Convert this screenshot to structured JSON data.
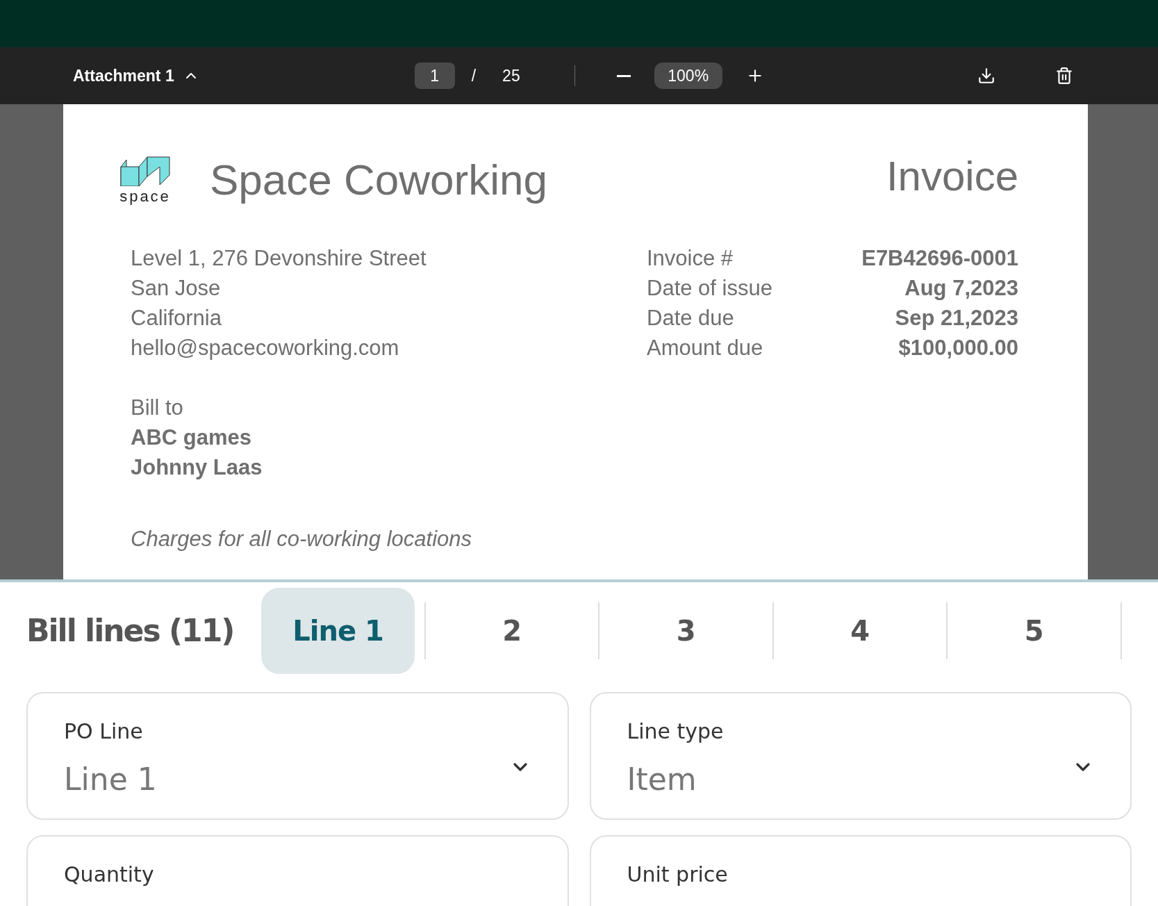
{
  "toolbar": {
    "attachment": "Attachment 1",
    "page": "1",
    "separator": "/",
    "page_count": "25",
    "zoom": "100%"
  },
  "invoice": {
    "logo_text": "space",
    "company": "Space Coworking",
    "title": "Invoice",
    "address": [
      "Level 1, 276 Devonshire Street",
      "San Jose",
      "California",
      "hello@spacecoworking.com"
    ],
    "details": [
      {
        "label": "Invoice #",
        "value": "E7B42696-0001"
      },
      {
        "label": "Date of issue",
        "value": "Aug 7,2023"
      },
      {
        "label": "Date due",
        "value": "Sep 21,2023"
      },
      {
        "label": "Amount due",
        "value": "$100,000.00"
      }
    ],
    "bill_to": {
      "label": "Bill to",
      "lines": [
        "ABC games",
        "Johnny Laas"
      ]
    },
    "note": "Charges for all co-working locations"
  },
  "bill_lines": {
    "title": "Bill lines (11)",
    "tabs": [
      {
        "label": "Line 1",
        "selected": true
      },
      {
        "label": "2",
        "selected": false
      },
      {
        "label": "3",
        "selected": false
      },
      {
        "label": "4",
        "selected": false
      },
      {
        "label": "5",
        "selected": false
      }
    ]
  },
  "fields": [
    {
      "label": "PO Line",
      "value": "Line 1",
      "kind": "dropdown"
    },
    {
      "label": "Line type",
      "value": "Item",
      "kind": "dropdown"
    },
    {
      "label": "Quantity",
      "kind": "text"
    },
    {
      "label": "Unit price",
      "kind": "text"
    }
  ]
}
